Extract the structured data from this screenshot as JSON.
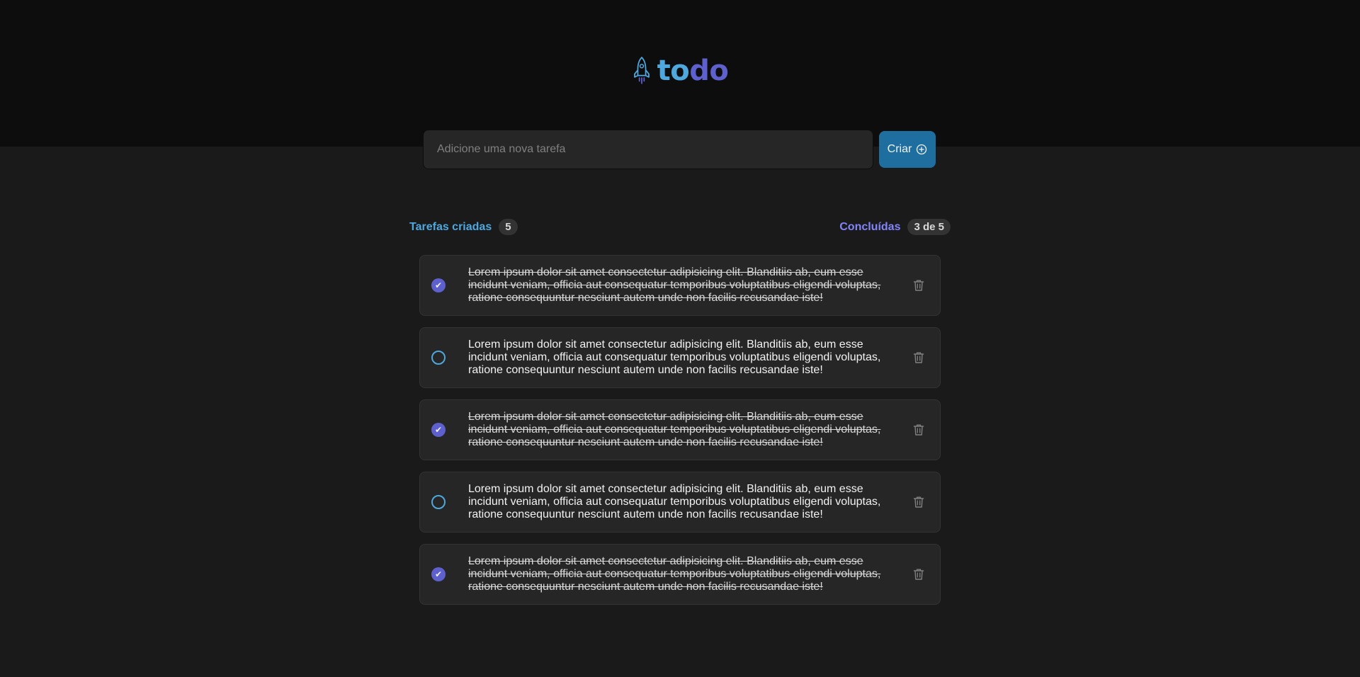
{
  "logo": {
    "text_part1": "to",
    "text_part2": "do",
    "icon": "rocket-icon"
  },
  "create": {
    "placeholder": "Adicione uma nova tarefa",
    "value": "",
    "button_label": "Criar",
    "button_icon": "plus-circle-icon"
  },
  "summary": {
    "created_label": "Tarefas criadas",
    "created_count": "5",
    "done_label": "Concluídas",
    "done_count": "3 de 5"
  },
  "tasks": [
    {
      "text": "Lorem ipsum dolor sit amet consectetur adipisicing elit. Blanditiis ab, eum esse incidunt veniam, officia aut consequatur temporibus voluptatibus eligendi voluptas, ratione consequuntur nesciunt autem unde non facilis recusandae iste!",
      "done": true
    },
    {
      "text": "Lorem ipsum dolor sit amet consectetur adipisicing elit. Blanditiis ab, eum esse incidunt veniam, officia aut consequatur temporibus voluptatibus eligendi voluptas, ratione consequuntur nesciunt autem unde non facilis recusandae iste!",
      "done": false
    },
    {
      "text": "Lorem ipsum dolor sit amet consectetur adipisicing elit. Blanditiis ab, eum esse incidunt veniam, officia aut consequatur temporibus voluptatibus eligendi voluptas, ratione consequuntur nesciunt autem unde non facilis recusandae iste!",
      "done": true
    },
    {
      "text": "Lorem ipsum dolor sit amet consectetur adipisicing elit. Blanditiis ab, eum esse incidunt veniam, officia aut consequatur temporibus voluptatibus eligendi voluptas, ratione consequuntur nesciunt autem unde non facilis recusandae iste!",
      "done": false
    },
    {
      "text": "Lorem ipsum dolor sit amet consectetur adipisicing elit. Blanditiis ab, eum esse incidunt veniam, officia aut consequatur temporibus voluptatibus eligendi voluptas, ratione consequuntur nesciunt autem unde non facilis recusandae iste!",
      "done": true
    }
  ],
  "colors": {
    "header_bg": "#0d0d0d",
    "page_bg": "#1a1a1a",
    "blue": "#4ea8de",
    "blue_dark": "#1e6f9f",
    "purple": "#5e60ce",
    "purple_light": "#8284fa",
    "card_bg": "#262626"
  }
}
